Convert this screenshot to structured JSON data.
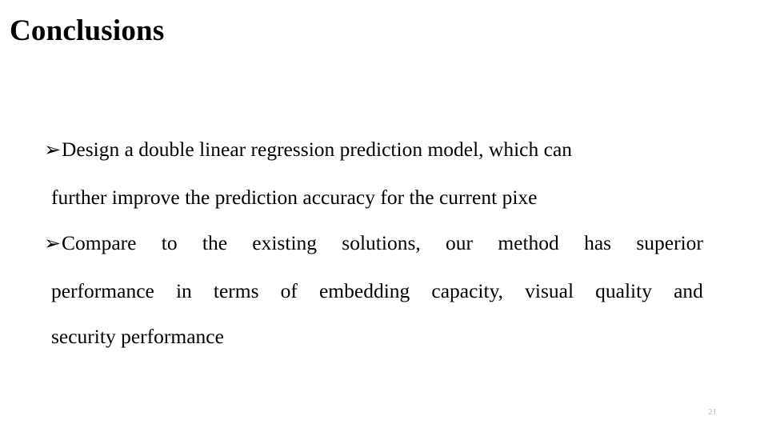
{
  "slide": {
    "title": "Conclusions",
    "page_number": "21",
    "text_color": "#000000",
    "background_color": "#ffffff",
    "page_number_color": "#b9b9b9",
    "bullet_glyph": "➢",
    "bullets": [
      {
        "id": "bullet-1",
        "full_text": "Design a double linear regression prediction model, which can further improve the prediction accuracy for the current pixe",
        "lines": [
          {
            "id": "line-1",
            "text": "Design a double linear regression prediction model, which can",
            "justified": false
          },
          {
            "id": "line-2",
            "text": "further improve the prediction accuracy for the current pixe",
            "justified": false
          }
        ]
      },
      {
        "id": "bullet-2",
        "full_text": "Compare to the existing solutions, our method has superior performance in terms of embedding capacity, visual quality and security performance",
        "lines": [
          {
            "id": "line-3",
            "text": "Compare to the existing solutions, our method has superior",
            "justified": true,
            "words": [
              "Compare",
              "to",
              "the",
              "existing",
              "solutions,",
              "our",
              "method",
              "has",
              "superior"
            ]
          },
          {
            "id": "line-4",
            "text": "performance in terms of embedding capacity, visual quality and",
            "justified": true,
            "words": [
              "performance",
              "in",
              "terms",
              "of",
              "embedding",
              "capacity,",
              "visual",
              "quality",
              "and"
            ]
          },
          {
            "id": "line-5",
            "text": "security performance",
            "justified": false
          }
        ]
      }
    ]
  }
}
